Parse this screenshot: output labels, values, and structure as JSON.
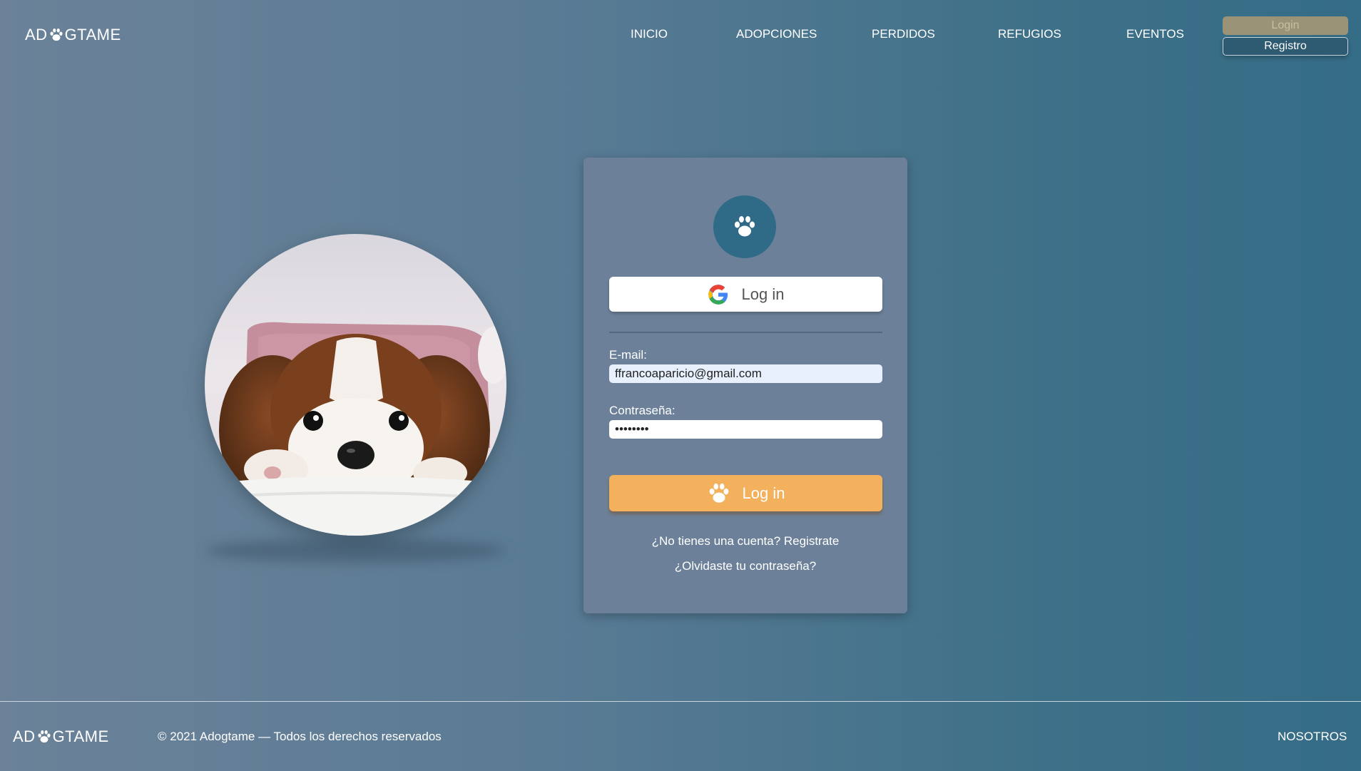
{
  "header": {
    "logo_left": "AD",
    "logo_right": "GTAME",
    "nav": [
      "INICIO",
      "ADOPCIONES",
      "PERDIDOS",
      "REFUGIOS",
      "EVENTOS"
    ],
    "login_label": "Login",
    "register_label": "Registro"
  },
  "login_card": {
    "google_label": "Log in",
    "email_label": "E-mail:",
    "email_value": "ffrancoaparicio@gmail.com",
    "password_label": "Contraseña:",
    "password_value": "••••••••",
    "submit_label": "Log in",
    "register_link": "¿No tienes una cuenta? Registrate",
    "forgot_link": "¿Olvidaste tu contraseña?"
  },
  "footer": {
    "logo_left": "AD",
    "logo_right": "GTAME",
    "copyright": "© 2021 Adogtame — Todos los derechos reservados",
    "about_link": "NOSOTROS"
  },
  "colors": {
    "accent": "#f3b15d",
    "icon_bg": "#2f6a86",
    "card_bg": "#6c8199"
  }
}
